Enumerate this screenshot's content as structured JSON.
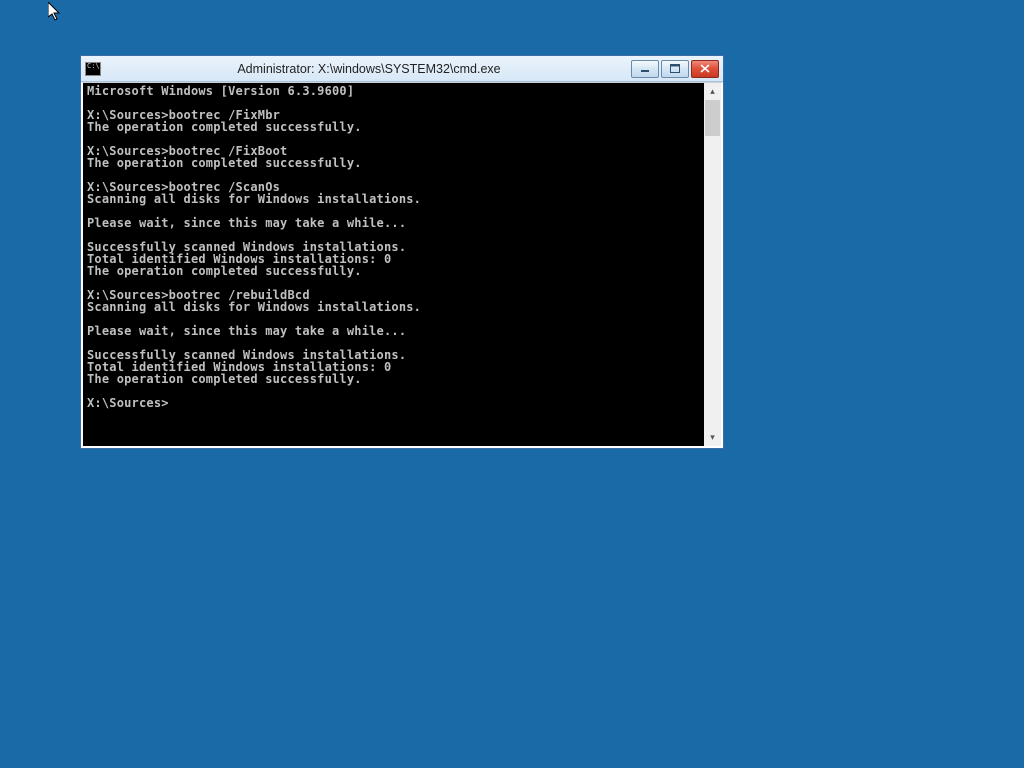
{
  "window": {
    "title": "Administrator: X:\\windows\\SYSTEM32\\cmd.exe",
    "icon_text": "C:\\."
  },
  "console": {
    "lines": [
      "Microsoft Windows [Version 6.3.9600]",
      "",
      "X:\\Sources>bootrec /FixMbr",
      "The operation completed successfully.",
      "",
      "X:\\Sources>bootrec /FixBoot",
      "The operation completed successfully.",
      "",
      "X:\\Sources>bootrec /ScanOs",
      "Scanning all disks for Windows installations.",
      "",
      "Please wait, since this may take a while...",
      "",
      "Successfully scanned Windows installations.",
      "Total identified Windows installations: 0",
      "The operation completed successfully.",
      "",
      "X:\\Sources>bootrec /rebuildBcd",
      "Scanning all disks for Windows installations.",
      "",
      "Please wait, since this may take a while...",
      "",
      "Successfully scanned Windows installations.",
      "Total identified Windows installations: 0",
      "The operation completed successfully.",
      "",
      "X:\\Sources>"
    ]
  },
  "buttons": {
    "minimize_glyph": "─",
    "maximize_glyph": "▭",
    "close_glyph": "✕"
  },
  "scroll": {
    "up_glyph": "▴",
    "down_glyph": "▾"
  }
}
